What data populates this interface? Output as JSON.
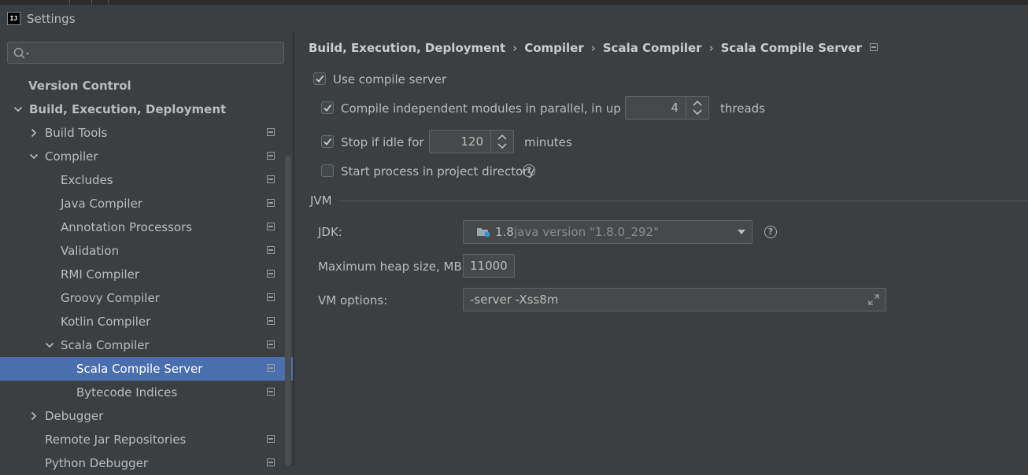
{
  "window": {
    "title": "Settings",
    "app_icon_text": "IJ"
  },
  "search": {
    "placeholder": "",
    "value": ""
  },
  "tree": [
    {
      "label": "Version Control",
      "depth": 0,
      "bold": true,
      "chevron": "none",
      "project_icon": false,
      "selected": false
    },
    {
      "label": "Build, Execution, Deployment",
      "depth": 0,
      "bold": true,
      "chevron": "down",
      "project_icon": false,
      "selected": false
    },
    {
      "label": "Build Tools",
      "depth": 1,
      "bold": false,
      "chevron": "right",
      "project_icon": true,
      "selected": false
    },
    {
      "label": "Compiler",
      "depth": 1,
      "bold": false,
      "chevron": "down",
      "project_icon": true,
      "selected": false
    },
    {
      "label": "Excludes",
      "depth": 2,
      "bold": false,
      "chevron": "none",
      "project_icon": true,
      "selected": false
    },
    {
      "label": "Java Compiler",
      "depth": 2,
      "bold": false,
      "chevron": "none",
      "project_icon": true,
      "selected": false
    },
    {
      "label": "Annotation Processors",
      "depth": 2,
      "bold": false,
      "chevron": "none",
      "project_icon": true,
      "selected": false
    },
    {
      "label": "Validation",
      "depth": 2,
      "bold": false,
      "chevron": "none",
      "project_icon": true,
      "selected": false
    },
    {
      "label": "RMI Compiler",
      "depth": 2,
      "bold": false,
      "chevron": "none",
      "project_icon": true,
      "selected": false
    },
    {
      "label": "Groovy Compiler",
      "depth": 2,
      "bold": false,
      "chevron": "none",
      "project_icon": true,
      "selected": false
    },
    {
      "label": "Kotlin Compiler",
      "depth": 2,
      "bold": false,
      "chevron": "none",
      "project_icon": true,
      "selected": false
    },
    {
      "label": "Scala Compiler",
      "depth": 2,
      "bold": false,
      "chevron": "down",
      "project_icon": true,
      "selected": false
    },
    {
      "label": "Scala Compile Server",
      "depth": 3,
      "bold": false,
      "chevron": "none",
      "project_icon": true,
      "selected": true
    },
    {
      "label": "Bytecode Indices",
      "depth": 3,
      "bold": false,
      "chevron": "none",
      "project_icon": true,
      "selected": false
    },
    {
      "label": "Debugger",
      "depth": 1,
      "bold": false,
      "chevron": "right",
      "project_icon": false,
      "selected": false
    },
    {
      "label": "Remote Jar Repositories",
      "depth": 1,
      "bold": false,
      "chevron": "none",
      "project_icon": true,
      "selected": false
    },
    {
      "label": "Python Debugger",
      "depth": 1,
      "bold": false,
      "chevron": "none",
      "project_icon": true,
      "selected": false
    }
  ],
  "breadcrumb": [
    "Build, Execution, Deployment",
    "Compiler",
    "Scala Compiler",
    "Scala Compile Server"
  ],
  "settings": {
    "use_compile_server": {
      "label": "Use compile server",
      "checked": true
    },
    "parallel": {
      "label": "Compile independent modules in parallel, in up to",
      "checked": true,
      "value": "4",
      "suffix": "threads"
    },
    "idle": {
      "label": "Stop if idle for",
      "checked": true,
      "value": "120",
      "suffix": "minutes"
    },
    "project_dir": {
      "label": "Start process in project directory",
      "checked": false,
      "help": "?"
    }
  },
  "jvm": {
    "section_label": "JVM",
    "jdk_label": "JDK:",
    "jdk_version": "1.8",
    "jdk_description": "java version \"1.8.0_292\"",
    "jdk_help": "?",
    "heap_label": "Maximum heap size, MB:",
    "heap_value": "11000",
    "vm_options_label": "VM options:",
    "vm_options_value": "-server -Xss8m"
  },
  "colors": {
    "background": "#3c3f41",
    "selection": "#4b6eaf",
    "text": "#bbbbbb",
    "field": "#45494a",
    "checkbox_checked": "#43494a"
  }
}
